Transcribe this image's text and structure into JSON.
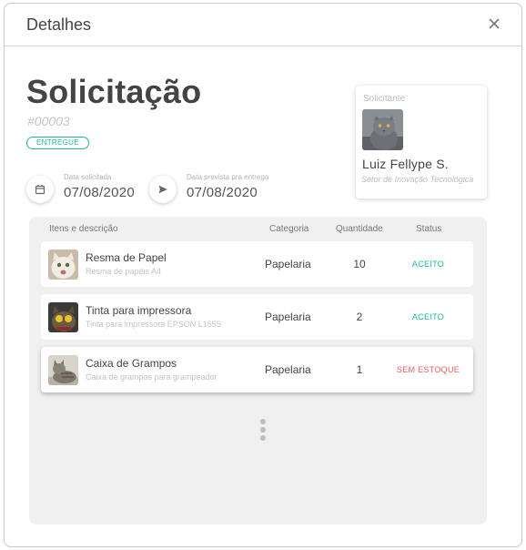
{
  "modal": {
    "title": "Detalhes"
  },
  "request": {
    "title": "Solicitação",
    "number": "#00003",
    "status": "ENTREGUE",
    "status_color": "#1fb89a"
  },
  "dates": {
    "requested_caption": "Data solicitada",
    "requested_value": "07/08/2020",
    "expected_caption": "Data prevista pra entrega",
    "expected_value": "07/08/2020"
  },
  "requester": {
    "label": "Solicitante",
    "name": "Luiz Fellype S.",
    "department": "Setor de Inovação Tecnológica"
  },
  "table": {
    "headers": {
      "items": "Itens e descrição",
      "category": "Categoria",
      "quantity": "Quantidade",
      "status": "Status"
    },
    "rows": [
      {
        "name": "Resma de Papel",
        "description": "Resma de papéis A4",
        "category": "Papelaria",
        "quantity": "10",
        "status": "ACEITO",
        "status_color": "#1fb89a",
        "icon": "cat-photo-white"
      },
      {
        "name": "Tinta para impressora",
        "description": "Tinta para impressora  EPSON L1555",
        "category": "Papelaria",
        "quantity": "2",
        "status": "ACEITO",
        "status_color": "#1fb89a",
        "icon": "cat-photo-sunglasses"
      },
      {
        "name": "Caixa de Grampos",
        "description": "Caixa de grampos para grampeador",
        "category": "Papelaria",
        "quantity": "1",
        "status": "SEM ESTOQUE",
        "status_color": "#ec5e5e",
        "icon": "cat-photo-tabby"
      }
    ]
  },
  "colors": {
    "accent": "#1fb89a",
    "danger": "#ec5e5e",
    "panel": "#f0f0f0"
  }
}
